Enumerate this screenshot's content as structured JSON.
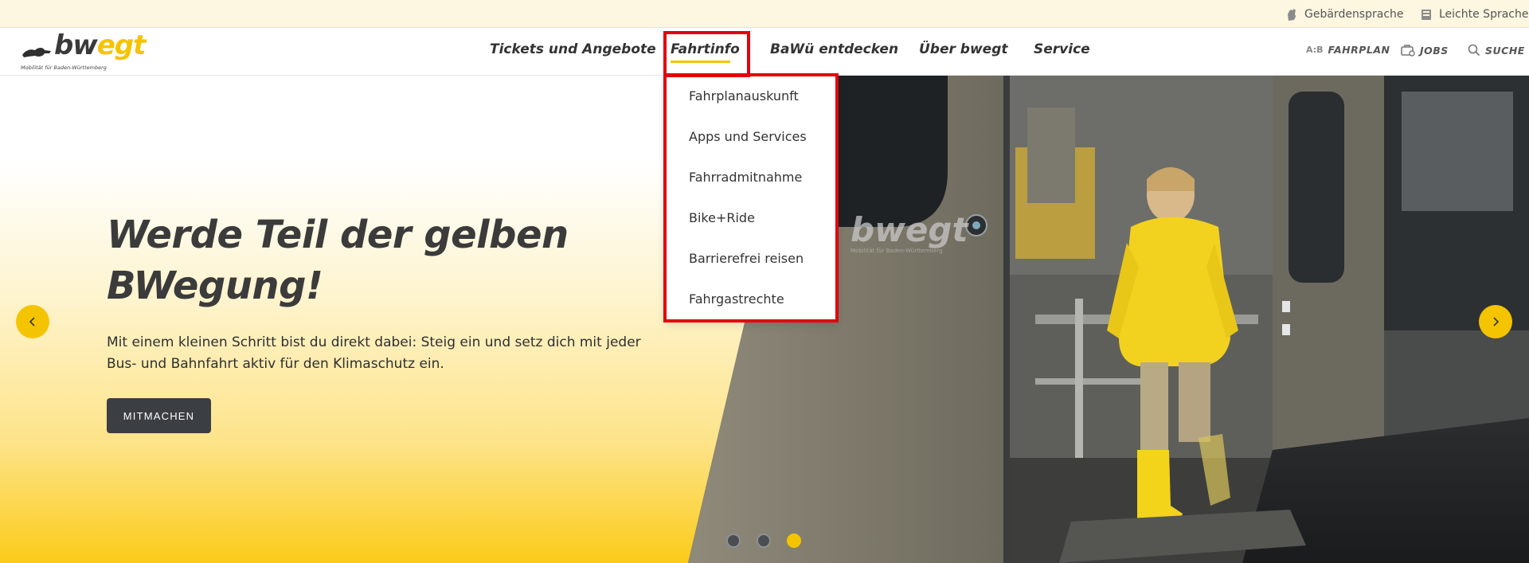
{
  "utility": {
    "sign_language": "Gebärdensprache",
    "easy_language": "Leichte Sprache"
  },
  "logo": {
    "word_bw": "bw",
    "word_egt": "egt",
    "tagline": "Mobilität für Baden-Württemberg"
  },
  "nav": {
    "items": [
      {
        "label": "Tickets und Angebote"
      },
      {
        "label": "Fahrtinfo"
      },
      {
        "label": "BaWü entdecken"
      },
      {
        "label": "Über bwegt"
      },
      {
        "label": "Service"
      }
    ],
    "active_index": 1,
    "right": {
      "fahrplan_glyph": "A:B",
      "fahrplan": "FAHRPLAN",
      "jobs": "JOBS",
      "suche": "SUCHE"
    }
  },
  "dropdown": {
    "items": [
      {
        "label": "Fahrplanauskunft"
      },
      {
        "label": "Apps und Services"
      },
      {
        "label": "Fahrradmitnahme"
      },
      {
        "label": "Bike+Ride"
      },
      {
        "label": "Barrierefrei reisen"
      },
      {
        "label": "Fahrgastrechte"
      }
    ]
  },
  "hero": {
    "title_line1": "Werde Teil der gelben",
    "title_line2": "BWegung!",
    "text": "Mit einem kleinen Schritt bist du direkt dabei: Steig ein und setz dich mit jeder Bus- und Bahnfahrt aktiv für den Klimaschutz ein.",
    "cta": "MITMACHEN",
    "train_logo": "bwegt",
    "train_logo_sub": "Mobilität für Baden-Württemberg"
  },
  "carousel": {
    "slide_count": 3,
    "active_slide": 3
  },
  "colors": {
    "accent": "#f5c400",
    "highlight": "#e3000f",
    "dark": "#3b3e42"
  }
}
